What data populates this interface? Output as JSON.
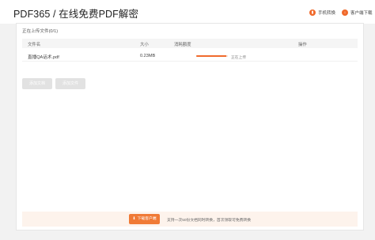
{
  "header": {
    "title": "PDF365 / 在线免费PDF解密",
    "links": {
      "phone_convert": "手机转换",
      "client_download": "客户端下载"
    }
  },
  "upload": {
    "status_text": "正在上传文件(0/1)",
    "columns": {
      "name": "文件名",
      "size": "大小",
      "quota": "消耗额度",
      "actions": "操作"
    },
    "files": [
      {
        "name": "直播QA话术.pdf",
        "size": "0.23MB",
        "progress": 0.95,
        "status": "正在上传"
      }
    ],
    "buttons": {
      "add": "添加文档",
      "add_file": "添加文件"
    }
  },
  "footer_bar": {
    "download_button": "下载客户端",
    "info_text": "支持一次50份文档同时转换，首次领取可免费转换"
  },
  "colors": {
    "accent": "#f06a2c",
    "progress_track": "#f5d6c6",
    "footer_bg": "#fdf3ec"
  }
}
